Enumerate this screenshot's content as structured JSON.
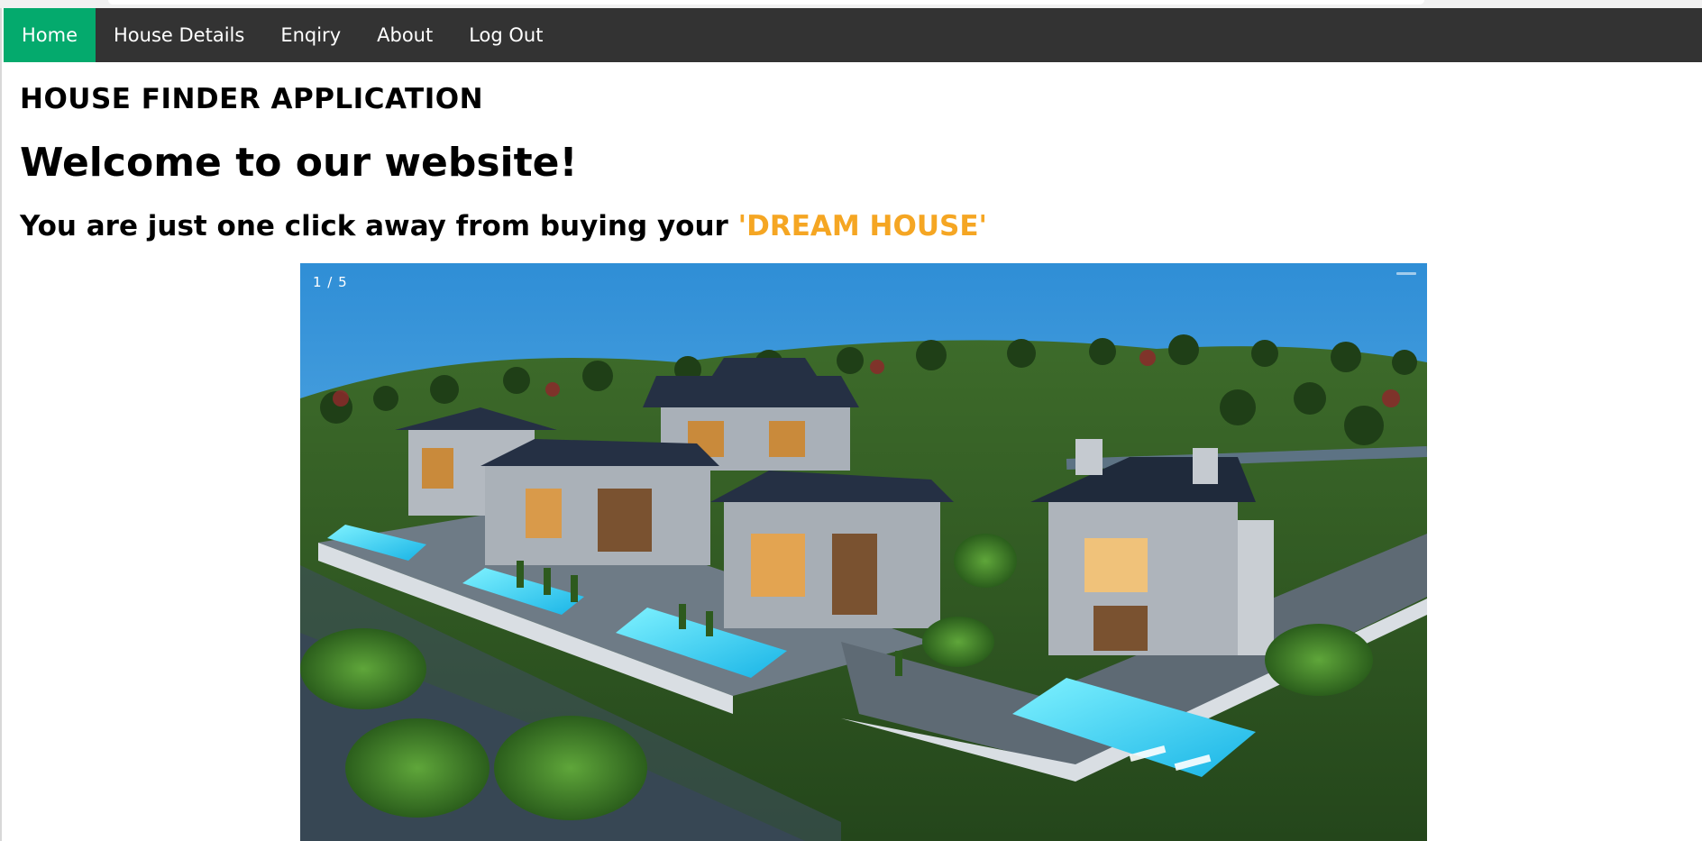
{
  "nav": {
    "items": [
      {
        "label": "Home",
        "active": true
      },
      {
        "label": "House Details",
        "active": false
      },
      {
        "label": "Enqiry",
        "active": false
      },
      {
        "label": "About",
        "active": false
      },
      {
        "label": "Log Out",
        "active": false
      }
    ]
  },
  "page": {
    "app_title": "HOUSE FINDER APPLICATION",
    "welcome": "Welcome to our website!",
    "tagline_prefix": "You are just one click away from buying your ",
    "tagline_highlight": "'DREAM HOUSE'"
  },
  "slideshow": {
    "counter": "1 / 5",
    "current": 1,
    "total": 5,
    "image_subject": "aerial render of villas with swimming pools"
  },
  "colors": {
    "navbar": "#333333",
    "active_tab": "#04AA6D",
    "highlight": "#f5a623"
  }
}
